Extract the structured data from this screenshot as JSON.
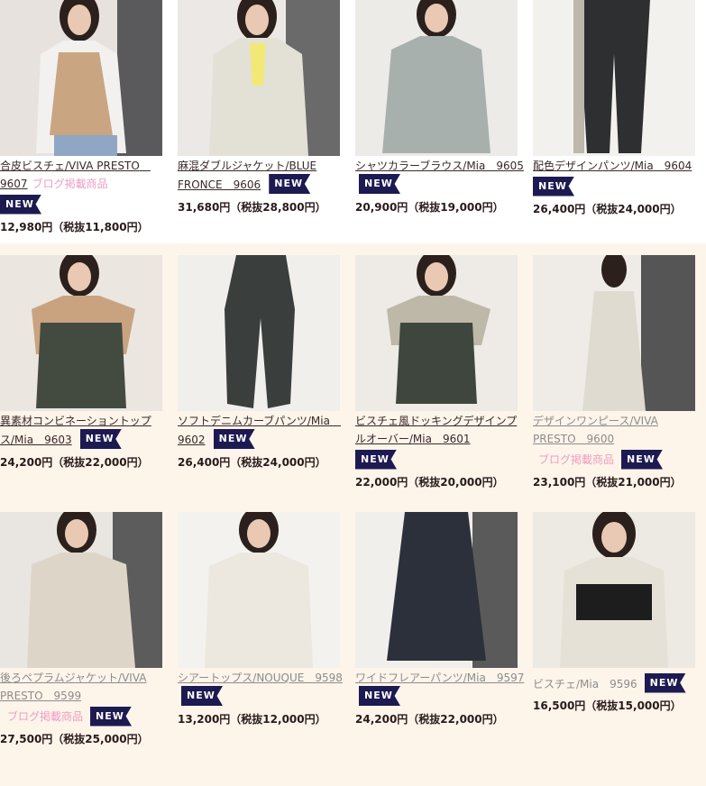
{
  "badge_text": "NEW",
  "blog_text": "ブログ掲載商品",
  "products": [
    {
      "title": "合皮ビスチェ/VIVA PRESTO　9607",
      "price": "12,980円（税抜11,800円）"
    },
    {
      "title": "麻混ダブルジャケット/BLUE FRONCE　9606",
      "price": "31,680円（税抜28,800円）"
    },
    {
      "title": "シャツカラーブラウス/Mia　9605",
      "price": "20,900円（税抜19,000円）"
    },
    {
      "title": "配色デザインパンツ/Mia　9604",
      "price": "26,400円（税抜24,000円）"
    },
    {
      "title": "異素材コンビネーショントップス/Mia　9603",
      "price": "24,200円（税抜22,000円）"
    },
    {
      "title": "ソフトデニムカーブパンツ/Mia　9602",
      "price": "26,400円（税抜24,000円）"
    },
    {
      "title": "ビスチェ風ドッキングデザインプルオーバー/Mia　9601",
      "price": "22,000円（税抜20,000円）"
    },
    {
      "title": "デザインワンピース/VIVA PRESTO　9600",
      "price": "23,100円（税抜21,000円）"
    },
    {
      "title": "後ろペプラムジャケット/VIVA PRESTO　9599",
      "price": "27,500円（税抜25,000円）"
    },
    {
      "title": "シアートップス/NOUQUE　9598",
      "price": "13,200円（税抜12,000円）"
    },
    {
      "title": "ワイドフレアーパンツ/Mia　9597",
      "price": "24,200円（税抜22,000円）"
    },
    {
      "title": "ビスチェ/Mia　9596",
      "price": "16,500円（税抜15,000円）"
    }
  ],
  "colors": {
    "badge": "#1d1a52",
    "blog": "#ef9cc3",
    "band": "#fdf4ea"
  }
}
